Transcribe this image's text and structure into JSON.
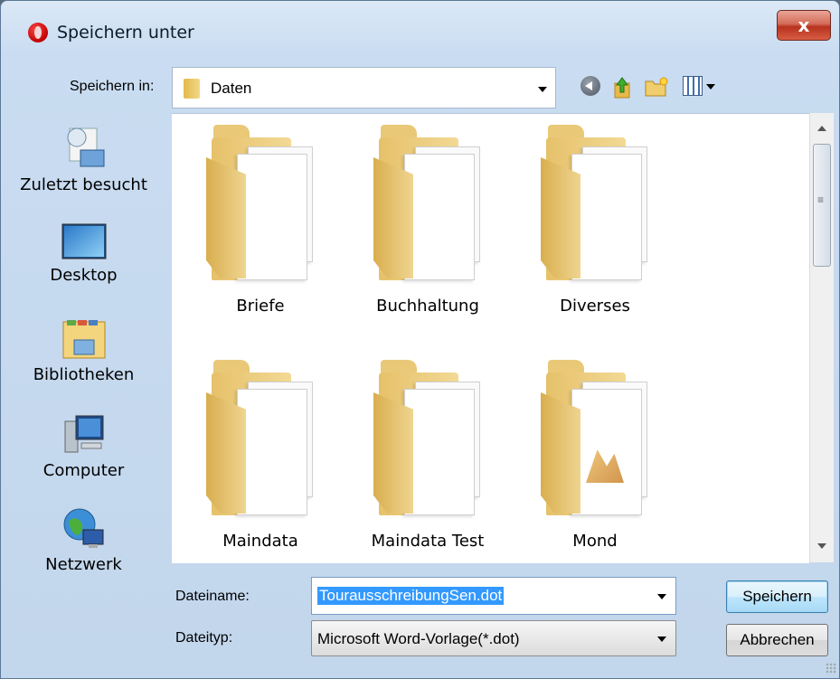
{
  "window": {
    "title": "Speichern unter",
    "close_label": "x"
  },
  "toolbar": {
    "lookin_label": "Speichern in:",
    "lookin_value": "Daten",
    "icons": [
      "back-icon",
      "up-folder-icon",
      "new-folder-icon",
      "views-icon"
    ]
  },
  "sidebar": {
    "items": [
      {
        "label": "Zuletzt besucht",
        "icon": "recent-places-icon"
      },
      {
        "label": "Desktop",
        "icon": "desktop-icon"
      },
      {
        "label": "Bibliotheken",
        "icon": "libraries-icon"
      },
      {
        "label": "Computer",
        "icon": "computer-icon"
      },
      {
        "label": "Netzwerk",
        "icon": "network-icon"
      }
    ]
  },
  "files": {
    "items": [
      {
        "name": "Briefe"
      },
      {
        "name": "Buchhaltung"
      },
      {
        "name": "Diverses"
      },
      {
        "name": "Maindata"
      },
      {
        "name": "Maindata Test"
      },
      {
        "name": "Mond"
      }
    ]
  },
  "form": {
    "filename_label": "Dateiname:",
    "filename_value": "TourausschreibungSen.dot",
    "filetype_label": "Dateityp:",
    "filetype_value": "Microsoft Word-Vorlage(*.dot)"
  },
  "buttons": {
    "save_label": "Speichern",
    "cancel_label": "Abbrechen"
  }
}
